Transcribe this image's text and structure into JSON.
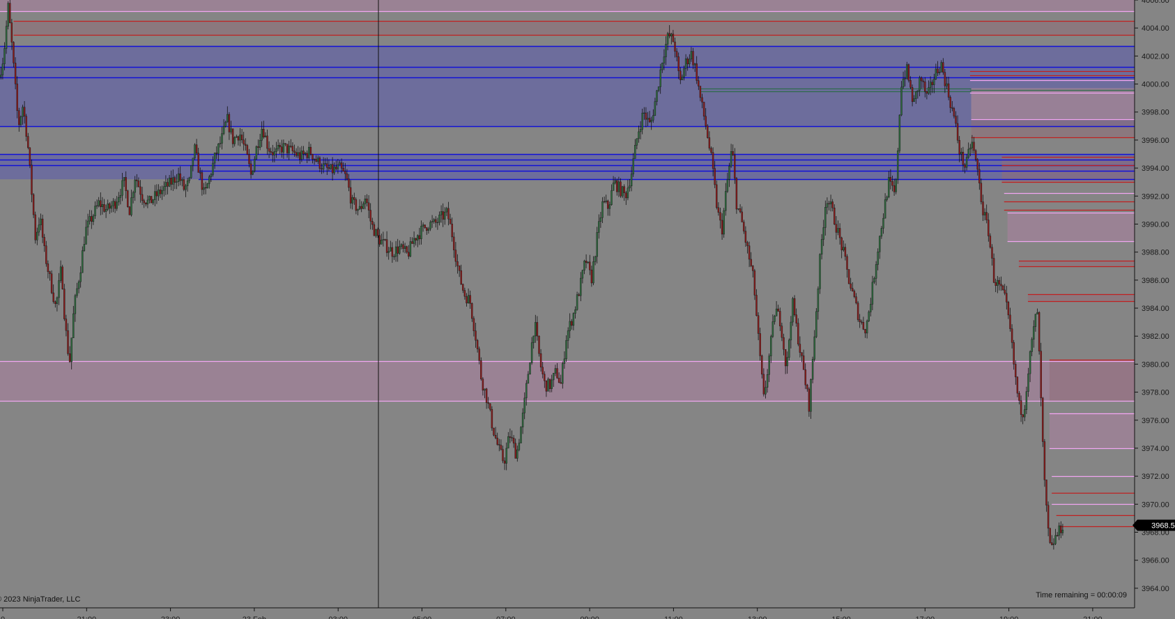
{
  "window": {
    "copyright": "© 2023 NinjaTrader, LLC",
    "timer": "Time remaining = 00:00:09"
  },
  "colors": {
    "background": "#858585",
    "bull_candle": "#2f6b3f",
    "bear_candle": "#8b1c1c",
    "wick": "#111111",
    "blue_zone_fill": "#6a6a9e",
    "blue_line": "#1010d8",
    "pink_zone_fill": "#9c8296",
    "pink_line": "#f2a6f2",
    "red_line": "#c02020",
    "green_line": "#2e6a4a",
    "price_tag_bg": "#000000",
    "price_tag_text": "#ffffff"
  },
  "chart_data": {
    "type": "candlestick",
    "instrument_note": "",
    "ylim": [
      3962.6,
      4006.0
    ],
    "ytick_step": 2,
    "y_tick_labels": [
      "4006.00",
      "4004.00",
      "4002.00",
      "4000.00",
      "3998.00",
      "3996.00",
      "3994.00",
      "3992.00",
      "3990.00",
      "3988.00",
      "3986.00",
      "3984.00",
      "3982.00",
      "3980.00",
      "3978.00",
      "3976.00",
      "3974.00",
      "3972.00",
      "3970.00",
      "3968.00",
      "3966.00",
      "3964.00"
    ],
    "x_tick_labels": [
      "0",
      "21:00",
      "23:00",
      "23 Feb",
      "03:00",
      "05:00",
      "07:00",
      "09:00",
      "11:00",
      "13:00",
      "15:00",
      "17:00",
      "19:00",
      "21:00"
    ],
    "current_price": "3968.50",
    "cursor_time": "05:00",
    "price_path": [
      [
        0.0,
        4000.5
      ],
      [
        0.004,
        4002
      ],
      [
        0.008,
        4005.5
      ],
      [
        0.011,
        4003
      ],
      [
        0.014,
        4000
      ],
      [
        0.017,
        3997
      ],
      [
        0.021,
        3998.5
      ],
      [
        0.025,
        3996
      ],
      [
        0.029,
        3992
      ],
      [
        0.032,
        3989
      ],
      [
        0.036,
        3990.5
      ],
      [
        0.04,
        3988
      ],
      [
        0.045,
        3986
      ],
      [
        0.05,
        3984
      ],
      [
        0.055,
        3987
      ],
      [
        0.058,
        3983
      ],
      [
        0.062,
        3980
      ],
      [
        0.066,
        3984
      ],
      [
        0.072,
        3987
      ],
      [
        0.076,
        3989.5
      ],
      [
        0.082,
        3990.5
      ],
      [
        0.088,
        3991.5
      ],
      [
        0.095,
        3991
      ],
      [
        0.102,
        3991.5
      ],
      [
        0.11,
        3993
      ],
      [
        0.115,
        3991
      ],
      [
        0.12,
        3993.5
      ],
      [
        0.126,
        3992
      ],
      [
        0.132,
        3991.5
      ],
      [
        0.138,
        3992
      ],
      [
        0.145,
        3992.5
      ],
      [
        0.152,
        3993
      ],
      [
        0.158,
        3993.5
      ],
      [
        0.163,
        3992.5
      ],
      [
        0.168,
        3993
      ],
      [
        0.172,
        3995.5
      ],
      [
        0.177,
        3993.5
      ],
      [
        0.181,
        3992
      ],
      [
        0.186,
        3993.5
      ],
      [
        0.191,
        3995
      ],
      [
        0.196,
        3996
      ],
      [
        0.201,
        3997.5
      ],
      [
        0.206,
        3996
      ],
      [
        0.212,
        3996.5
      ],
      [
        0.218,
        3995
      ],
      [
        0.222,
        3993.5
      ],
      [
        0.227,
        3995.5
      ],
      [
        0.232,
        3997
      ],
      [
        0.237,
        3995.5
      ],
      [
        0.243,
        3995
      ],
      [
        0.25,
        3995.5
      ],
      [
        0.258,
        3995.2
      ],
      [
        0.266,
        3994.8
      ],
      [
        0.274,
        3995.2
      ],
      [
        0.28,
        3994.5
      ],
      [
        0.287,
        3994
      ],
      [
        0.293,
        3993.8
      ],
      [
        0.3,
        3994
      ],
      [
        0.306,
        3993.3
      ],
      [
        0.311,
        3991.5
      ],
      [
        0.318,
        3991
      ],
      [
        0.323,
        3992
      ],
      [
        0.328,
        3990
      ],
      [
        0.334,
        3989
      ],
      [
        0.34,
        3988.5
      ],
      [
        0.347,
        3988
      ],
      [
        0.353,
        3988.3
      ],
      [
        0.36,
        3987.8
      ],
      [
        0.366,
        3989
      ],
      [
        0.372,
        3989.5
      ],
      [
        0.378,
        3990
      ],
      [
        0.384,
        3990
      ],
      [
        0.39,
        3990.5
      ],
      [
        0.395,
        3990.8
      ],
      [
        0.4,
        3989
      ],
      [
        0.405,
        3986.5
      ],
      [
        0.41,
        3985
      ],
      [
        0.415,
        3984.5
      ],
      [
        0.42,
        3982
      ],
      [
        0.425,
        3979
      ],
      [
        0.43,
        3977.5
      ],
      [
        0.435,
        3975.5
      ],
      [
        0.44,
        3974
      ],
      [
        0.445,
        3973
      ],
      [
        0.45,
        3975
      ],
      [
        0.456,
        3973.5
      ],
      [
        0.462,
        3976.5
      ],
      [
        0.468,
        3980.5
      ],
      [
        0.472,
        3983
      ],
      [
        0.477,
        3980
      ],
      [
        0.481,
        3978.5
      ],
      [
        0.486,
        3978.5
      ],
      [
        0.491,
        3979.5
      ],
      [
        0.495,
        3978.5
      ],
      [
        0.5,
        3982
      ],
      [
        0.506,
        3983.5
      ],
      [
        0.512,
        3985.5
      ],
      [
        0.517,
        3987.5
      ],
      [
        0.522,
        3986
      ],
      [
        0.527,
        3989
      ],
      [
        0.532,
        3991.5
      ],
      [
        0.537,
        3991.2
      ],
      [
        0.542,
        3993
      ],
      [
        0.547,
        3992.5
      ],
      [
        0.552,
        3992
      ],
      [
        0.557,
        3993.5
      ],
      [
        0.563,
        3996.5
      ],
      [
        0.568,
        3998
      ],
      [
        0.574,
        3997
      ],
      [
        0.58,
        3999.5
      ],
      [
        0.585,
        4002
      ],
      [
        0.59,
        4003.5
      ],
      [
        0.595,
        4003
      ],
      [
        0.6,
        4000
      ],
      [
        0.605,
        4001.5
      ],
      [
        0.61,
        4002.2
      ],
      [
        0.614,
        4001
      ],
      [
        0.618,
        3999
      ],
      [
        0.623,
        3997
      ],
      [
        0.628,
        3994.5
      ],
      [
        0.633,
        3991
      ],
      [
        0.637,
        3989.5
      ],
      [
        0.641,
        3992.5
      ],
      [
        0.646,
        3995.5
      ],
      [
        0.65,
        3991.5
      ],
      [
        0.655,
        3990
      ],
      [
        0.66,
        3988
      ],
      [
        0.665,
        3986
      ],
      [
        0.67,
        3981
      ],
      [
        0.674,
        3977.5
      ],
      [
        0.678,
        3980
      ],
      [
        0.684,
        3984
      ],
      [
        0.689,
        3983
      ],
      [
        0.694,
        3979.5
      ],
      [
        0.699,
        3984.5
      ],
      [
        0.704,
        3982
      ],
      [
        0.709,
        3979.5
      ],
      [
        0.714,
        3977
      ],
      [
        0.719,
        3982.5
      ],
      [
        0.724,
        3988
      ],
      [
        0.729,
        3992
      ],
      [
        0.734,
        3991
      ],
      [
        0.739,
        3989.5
      ],
      [
        0.744,
        3988
      ],
      [
        0.749,
        3986
      ],
      [
        0.754,
        3984.5
      ],
      [
        0.759,
        3983
      ],
      [
        0.764,
        3982.5
      ],
      [
        0.769,
        3985
      ],
      [
        0.774,
        3988
      ],
      [
        0.779,
        3990.5
      ],
      [
        0.784,
        3993
      ],
      [
        0.79,
        3992
      ],
      [
        0.795,
        4000
      ],
      [
        0.8,
        4001
      ],
      [
        0.806,
        3998.5
      ],
      [
        0.812,
        4000.5
      ],
      [
        0.818,
        3999
      ],
      [
        0.824,
        4000.5
      ],
      [
        0.83,
        4001.5
      ],
      [
        0.836,
        3999.5
      ],
      [
        0.842,
        3997.5
      ],
      [
        0.847,
        3995
      ],
      [
        0.852,
        3994
      ],
      [
        0.857,
        3996
      ],
      [
        0.862,
        3994
      ],
      [
        0.867,
        3991
      ],
      [
        0.872,
        3989.5
      ],
      [
        0.877,
        3986
      ],
      [
        0.882,
        3985.5
      ],
      [
        0.887,
        3984.5
      ],
      [
        0.891,
        3982.5
      ],
      [
        0.895,
        3979.5
      ],
      [
        0.899,
        3977
      ],
      [
        0.903,
        3976.5
      ],
      [
        0.907,
        3979.5
      ],
      [
        0.911,
        3982
      ],
      [
        0.915,
        3984
      ],
      [
        0.918,
        3978
      ],
      [
        0.921,
        3972
      ],
      [
        0.924,
        3968.5
      ],
      [
        0.927,
        3966.5
      ],
      [
        0.93,
        3967.5
      ],
      [
        0.934,
        3968
      ],
      [
        0.937,
        3968.5
      ]
    ],
    "zones": [
      {
        "kind": "pink",
        "top": 4006.0,
        "bottom": 4005.2,
        "x0": 0.0,
        "x1": 1.0
      },
      {
        "kind": "red",
        "top": 4004.5,
        "bottom": 4003.5,
        "x0": 0.012,
        "x1": 1.0
      },
      {
        "kind": "blue",
        "top": 4002.7,
        "bottom": 3997.0,
        "x0": 0.0,
        "x1": 1.0
      },
      {
        "kind": "blue",
        "top": 3995.0,
        "bottom": 3993.2,
        "x0": 0.0,
        "x1": 1.0
      },
      {
        "kind": "pink",
        "top": 3980.2,
        "bottom": 3977.4,
        "x0": 0.0,
        "x1": 1.0
      },
      {
        "kind": "pink",
        "top": 3999.7,
        "bottom": 3997.5,
        "x0": 0.856,
        "x1": 1.0
      },
      {
        "kind": "red",
        "top": 3997.5,
        "bottom": 3996.2,
        "x0": 0.856,
        "x1": 1.0
      },
      {
        "kind": "red",
        "top": 3994.8,
        "bottom": 3993.0,
        "x0": 0.883,
        "x1": 1.0
      },
      {
        "kind": "pink",
        "top": 3990.8,
        "bottom": 3988.8,
        "x0": 0.888,
        "x1": 1.0
      },
      {
        "kind": "red",
        "top": 3987.4,
        "bottom": 3987.0,
        "x0": 0.898,
        "x1": 1.0
      },
      {
        "kind": "red",
        "top": 3985.0,
        "bottom": 3984.5,
        "x0": 0.906,
        "x1": 1.0
      },
      {
        "kind": "red",
        "top": 3980.3,
        "bottom": 3977.4,
        "x0": 0.925,
        "x1": 1.0
      },
      {
        "kind": "pink",
        "top": 3976.5,
        "bottom": 3974.0,
        "x0": 0.925,
        "x1": 1.0
      }
    ],
    "lines": [
      {
        "kind": "blue",
        "price": 4002.7,
        "x0": 0.0,
        "x1": 1.0
      },
      {
        "kind": "blue",
        "price": 4001.2,
        "x0": 0.0,
        "x1": 1.0
      },
      {
        "kind": "blue",
        "price": 4000.5,
        "x0": 0.0,
        "x1": 1.0
      },
      {
        "kind": "blue",
        "price": 3997.0,
        "x0": 0.0,
        "x1": 1.0
      },
      {
        "kind": "blue",
        "price": 3995.0,
        "x0": 0.0,
        "x1": 1.0
      },
      {
        "kind": "blue",
        "price": 3994.6,
        "x0": 0.0,
        "x1": 1.0
      },
      {
        "kind": "blue",
        "price": 3994.2,
        "x0": 0.0,
        "x1": 1.0
      },
      {
        "kind": "blue",
        "price": 3993.8,
        "x0": 0.175,
        "x1": 1.0
      },
      {
        "kind": "blue",
        "price": 3993.2,
        "x0": 0.175,
        "x1": 1.0
      },
      {
        "kind": "pink",
        "price": 4005.2,
        "x0": 0.0,
        "x1": 1.0
      },
      {
        "kind": "red",
        "price": 4004.5,
        "x0": 0.012,
        "x1": 1.0
      },
      {
        "kind": "red",
        "price": 4003.5,
        "x0": 0.012,
        "x1": 1.0
      },
      {
        "kind": "pink",
        "price": 3980.2,
        "x0": 0.0,
        "x1": 1.0
      },
      {
        "kind": "pink",
        "price": 3977.4,
        "x0": 0.0,
        "x1": 1.0
      },
      {
        "kind": "green",
        "price": 3999.7,
        "x0": 0.618,
        "x1": 0.856
      },
      {
        "kind": "green",
        "price": 3999.5,
        "x0": 0.618,
        "x1": 0.856
      },
      {
        "kind": "red",
        "price": 4000.9,
        "x0": 0.855,
        "x1": 1.0
      },
      {
        "kind": "red",
        "price": 4000.6,
        "x0": 0.855,
        "x1": 1.0
      },
      {
        "kind": "pink",
        "price": 4000.3,
        "x0": 0.855,
        "x1": 1.0
      },
      {
        "kind": "green",
        "price": 3999.6,
        "x0": 0.855,
        "x1": 1.0
      },
      {
        "kind": "pink",
        "price": 3999.4,
        "x0": 0.855,
        "x1": 1.0
      },
      {
        "kind": "pink",
        "price": 3997.5,
        "x0": 0.856,
        "x1": 1.0
      },
      {
        "kind": "red",
        "price": 3996.2,
        "x0": 0.856,
        "x1": 1.0
      },
      {
        "kind": "red",
        "price": 3994.8,
        "x0": 0.883,
        "x1": 1.0
      },
      {
        "kind": "red",
        "price": 3994.2,
        "x0": 0.883,
        "x1": 1.0
      },
      {
        "kind": "red",
        "price": 3993.0,
        "x0": 0.883,
        "x1": 1.0
      },
      {
        "kind": "pink",
        "price": 3992.2,
        "x0": 0.885,
        "x1": 1.0
      },
      {
        "kind": "red",
        "price": 3991.6,
        "x0": 0.885,
        "x1": 1.0
      },
      {
        "kind": "red",
        "price": 3991.0,
        "x0": 0.885,
        "x1": 1.0
      },
      {
        "kind": "pink",
        "price": 3990.8,
        "x0": 0.888,
        "x1": 1.0
      },
      {
        "kind": "pink",
        "price": 3988.8,
        "x0": 0.888,
        "x1": 1.0
      },
      {
        "kind": "red",
        "price": 3987.4,
        "x0": 0.898,
        "x1": 1.0
      },
      {
        "kind": "red",
        "price": 3987.0,
        "x0": 0.898,
        "x1": 1.0
      },
      {
        "kind": "red",
        "price": 3985.0,
        "x0": 0.906,
        "x1": 1.0
      },
      {
        "kind": "red",
        "price": 3984.5,
        "x0": 0.906,
        "x1": 1.0
      },
      {
        "kind": "red",
        "price": 3980.3,
        "x0": 0.925,
        "x1": 1.0
      },
      {
        "kind": "pink",
        "price": 3976.5,
        "x0": 0.925,
        "x1": 1.0
      },
      {
        "kind": "pink",
        "price": 3974.0,
        "x0": 0.925,
        "x1": 1.0
      },
      {
        "kind": "pink",
        "price": 3972.0,
        "x0": 0.927,
        "x1": 1.0
      },
      {
        "kind": "red",
        "price": 3970.8,
        "x0": 0.927,
        "x1": 1.0
      },
      {
        "kind": "pink",
        "price": 3970.0,
        "x0": 0.927,
        "x1": 1.0
      },
      {
        "kind": "red",
        "price": 3969.2,
        "x0": 0.931,
        "x1": 1.0
      },
      {
        "kind": "red",
        "price": 3968.4,
        "x0": 0.933,
        "x1": 1.0
      }
    ]
  }
}
